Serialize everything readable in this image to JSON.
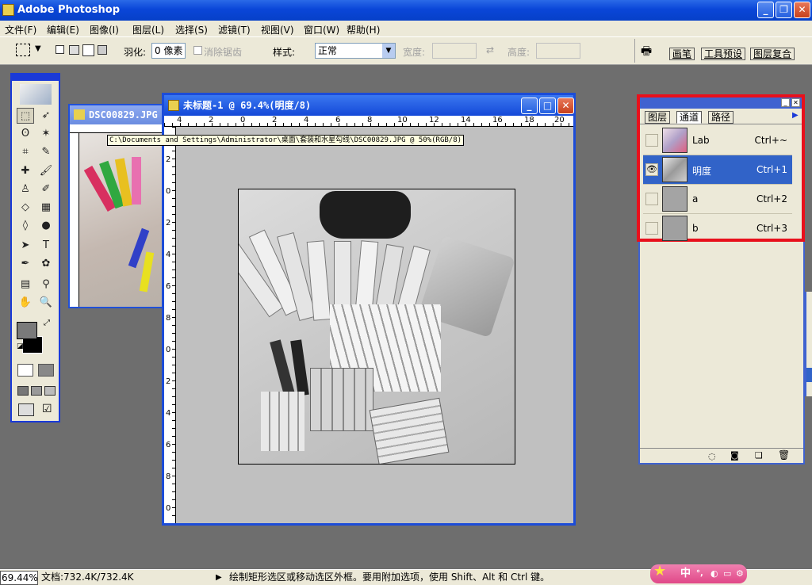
{
  "app": {
    "title": "Adobe Photoshop"
  },
  "menu": [
    "文件(F)",
    "编辑(E)",
    "图像(I)",
    "图层(L)",
    "选择(S)",
    "滤镜(T)",
    "视图(V)",
    "窗口(W)",
    "帮助(H)"
  ],
  "options": {
    "feather_label": "羽化:",
    "feather_value": "0 像素",
    "antialias_label": "消除锯齿",
    "style_label": "样式:",
    "style_value": "正常",
    "width_label": "宽度:",
    "height_label": "高度:",
    "palette_tabs": [
      "画笔",
      "工具预设",
      "图层复合"
    ]
  },
  "doc_back": {
    "title": "DSC00829.JPG",
    "tooltip": "C:\\Documents and Settings\\Administrator\\桌面\\套装和水星勾线\\DSC00829.JPG @ 50%(RGB/8)"
  },
  "doc_front": {
    "title": "未标题-1 @ 69.4%(明度/8)",
    "ruler_h": [
      "4",
      "2",
      "0",
      "2",
      "4",
      "6",
      "8",
      "10",
      "12",
      "14",
      "16",
      "18",
      "20"
    ],
    "ruler_v": [
      "2",
      "0",
      "2",
      "4",
      "6",
      "8",
      "0",
      "2",
      "4",
      "6",
      "8",
      "0"
    ]
  },
  "channels_panel": {
    "tabs": [
      "图层",
      "通道",
      "路径"
    ],
    "active_tab": "通道",
    "channels": [
      {
        "name": "Lab",
        "shortcut": "Ctrl+~",
        "visible": false,
        "selected": false
      },
      {
        "name": "明度",
        "shortcut": "Ctrl+1",
        "visible": true,
        "selected": true
      },
      {
        "name": "a",
        "shortcut": "Ctrl+2",
        "visible": false,
        "selected": false
      },
      {
        "name": "b",
        "shortcut": "Ctrl+3",
        "visible": false,
        "selected": false
      }
    ],
    "highlight_color": "#e8101c",
    "selection_color": "#3163c8"
  },
  "status": {
    "zoom": "69.44%",
    "doc_info": "文档:732.4K/732.4K",
    "hint": "绘制矩形选区或移动选区外框。要用附加选项，使用 Shift、Alt 和 Ctrl 键。"
  },
  "ime": {
    "label": "中"
  },
  "colors": {
    "accent": "#0a46d8",
    "workspace": "#6e6e6e",
    "chrome": "#ece9d8"
  }
}
